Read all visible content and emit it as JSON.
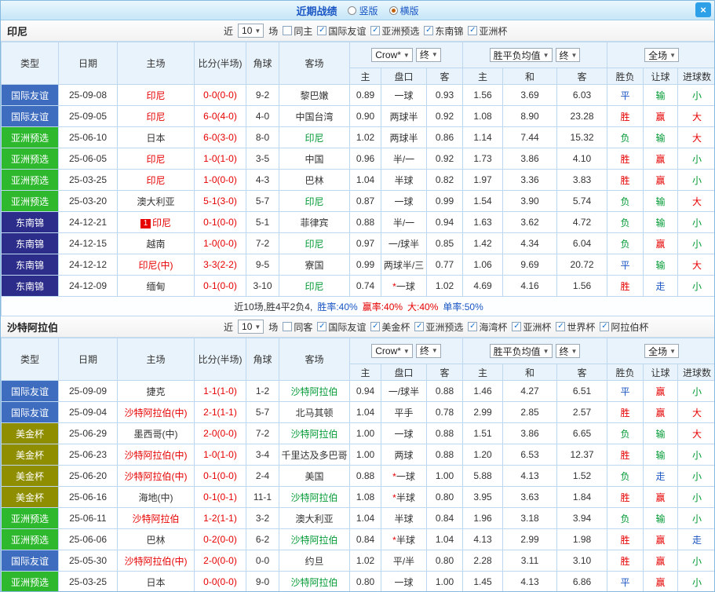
{
  "header": {
    "title": "近期战绩",
    "view_options": [
      {
        "label": "竖版",
        "selected": false
      },
      {
        "label": "横版",
        "selected": true
      }
    ],
    "close_icon": "×"
  },
  "icons": {
    "dropdown_arrow": "▼",
    "check": "✓"
  },
  "colors": {
    "red": "#e60000",
    "green": "#009933",
    "blue": "#1a56c4",
    "black": "#333333",
    "type_国际友谊": "#3e6cbf",
    "type_亚洲预选": "#2eb82e",
    "type_东南锦": "#2c2c8a",
    "type_美金杯": "#8e8e00"
  },
  "table_template": {
    "match_columns": [
      "类型",
      "日期",
      "主场",
      "比分(半场)",
      "角球",
      "客场"
    ],
    "odds_selects": [
      "Crow*",
      "终"
    ],
    "avg_selects": [
      "胜平负均值",
      "终"
    ],
    "result_select": "全场",
    "subheaders": [
      "主",
      "盘口",
      "客",
      "主",
      "和",
      "客",
      "胜负",
      "让球",
      "进球数"
    ],
    "filter": {
      "prefix": "近",
      "count": "10",
      "suffix": "场"
    }
  },
  "sections": [
    {
      "team": "印尼",
      "same_filter": {
        "label": "同主",
        "checked": false
      },
      "competitions": [
        {
          "label": "国际友谊",
          "checked": true
        },
        {
          "label": "亚洲预选",
          "checked": true
        },
        {
          "label": "东南锦",
          "checked": true
        },
        {
          "label": "亚洲杯",
          "checked": true
        }
      ],
      "rows": [
        {
          "type": "国际友谊",
          "date": "25-09-08",
          "home": "印尼",
          "home_color": "red",
          "home_badge": "",
          "score": "0-0(0-0)",
          "corners": "9-2",
          "away": "黎巴嫩",
          "away_color": "black",
          "h_home": "0.89",
          "handicap": "一球",
          "h_away": "0.93",
          "avg_home": "1.56",
          "avg_draw": "3.69",
          "avg_away": "6.03",
          "results": [
            [
              "平",
              "blue"
            ],
            [
              "输",
              "green"
            ],
            [
              "小",
              "green"
            ]
          ]
        },
        {
          "type": "国际友谊",
          "date": "25-09-05",
          "home": "印尼",
          "home_color": "red",
          "home_badge": "",
          "score": "6-0(4-0)",
          "corners": "4-0",
          "away": "中国台湾",
          "away_color": "black",
          "h_home": "0.90",
          "handicap": "两球半",
          "h_away": "0.92",
          "avg_home": "1.08",
          "avg_draw": "8.90",
          "avg_away": "23.28",
          "results": [
            [
              "胜",
              "red"
            ],
            [
              "赢",
              "red"
            ],
            [
              "大",
              "red"
            ]
          ]
        },
        {
          "type": "亚洲预选",
          "date": "25-06-10",
          "home": "日本",
          "home_color": "black",
          "home_badge": "",
          "score": "6-0(3-0)",
          "corners": "8-0",
          "away": "印尼",
          "away_color": "green",
          "h_home": "1.02",
          "handicap": "两球半",
          "h_away": "0.86",
          "avg_home": "1.14",
          "avg_draw": "7.44",
          "avg_away": "15.32",
          "results": [
            [
              "负",
              "green"
            ],
            [
              "输",
              "green"
            ],
            [
              "大",
              "red"
            ]
          ]
        },
        {
          "type": "亚洲预选",
          "date": "25-06-05",
          "home": "印尼",
          "home_color": "red",
          "home_badge": "",
          "score": "1-0(1-0)",
          "corners": "3-5",
          "away": "中国",
          "away_color": "black",
          "h_home": "0.96",
          "handicap": "半/一",
          "h_away": "0.92",
          "avg_home": "1.73",
          "avg_draw": "3.86",
          "avg_away": "4.10",
          "results": [
            [
              "胜",
              "red"
            ],
            [
              "赢",
              "red"
            ],
            [
              "小",
              "green"
            ]
          ]
        },
        {
          "type": "亚洲预选",
          "date": "25-03-25",
          "home": "印尼",
          "home_color": "red",
          "home_badge": "",
          "score": "1-0(0-0)",
          "corners": "4-3",
          "away": "巴林",
          "away_color": "black",
          "h_home": "1.04",
          "handicap": "半球",
          "h_away": "0.82",
          "avg_home": "1.97",
          "avg_draw": "3.36",
          "avg_away": "3.83",
          "results": [
            [
              "胜",
              "red"
            ],
            [
              "赢",
              "red"
            ],
            [
              "小",
              "green"
            ]
          ]
        },
        {
          "type": "亚洲预选",
          "date": "25-03-20",
          "home": "澳大利亚",
          "home_color": "black",
          "home_badge": "",
          "score": "5-1(3-0)",
          "corners": "5-7",
          "away": "印尼",
          "away_color": "green",
          "h_home": "0.87",
          "handicap": "一球",
          "h_away": "0.99",
          "avg_home": "1.54",
          "avg_draw": "3.90",
          "avg_away": "5.74",
          "results": [
            [
              "负",
              "green"
            ],
            [
              "输",
              "green"
            ],
            [
              "大",
              "red"
            ]
          ]
        },
        {
          "type": "东南锦",
          "date": "24-12-21",
          "home": "印尼",
          "home_color": "red",
          "home_badge": "1",
          "score": "0-1(0-0)",
          "corners": "5-1",
          "away": "菲律宾",
          "away_color": "black",
          "h_home": "0.88",
          "handicap": "半/一",
          "h_away": "0.94",
          "avg_home": "1.63",
          "avg_draw": "3.62",
          "avg_away": "4.72",
          "results": [
            [
              "负",
              "green"
            ],
            [
              "输",
              "green"
            ],
            [
              "小",
              "green"
            ]
          ]
        },
        {
          "type": "东南锦",
          "date": "24-12-15",
          "home": "越南",
          "home_color": "black",
          "home_badge": "",
          "score": "1-0(0-0)",
          "corners": "7-2",
          "away": "印尼",
          "away_color": "green",
          "h_home": "0.97",
          "handicap": "一/球半",
          "h_away": "0.85",
          "avg_home": "1.42",
          "avg_draw": "4.34",
          "avg_away": "6.04",
          "results": [
            [
              "负",
              "green"
            ],
            [
              "赢",
              "red"
            ],
            [
              "小",
              "green"
            ]
          ]
        },
        {
          "type": "东南锦",
          "date": "24-12-12",
          "home": "印尼(中)",
          "home_color": "red",
          "home_badge": "",
          "score": "3-3(2-2)",
          "corners": "9-5",
          "away": "寮国",
          "away_color": "black",
          "h_home": "0.99",
          "handicap": "两球半/三",
          "h_away": "0.77",
          "avg_home": "1.06",
          "avg_draw": "9.69",
          "avg_away": "20.72",
          "results": [
            [
              "平",
              "blue"
            ],
            [
              "输",
              "green"
            ],
            [
              "大",
              "red"
            ]
          ]
        },
        {
          "type": "东南锦",
          "date": "24-12-09",
          "home": "缅甸",
          "home_color": "black",
          "home_badge": "",
          "score": "0-1(0-0)",
          "corners": "3-10",
          "away": "印尼",
          "away_color": "green",
          "h_home": "0.74",
          "handicap": "*一球",
          "h_away": "1.02",
          "avg_home": "4.69",
          "avg_draw": "4.16",
          "avg_away": "1.56",
          "results": [
            [
              "胜",
              "red"
            ],
            [
              "走",
              "blue"
            ],
            [
              "小",
              "green"
            ]
          ]
        }
      ],
      "summary": [
        {
          "text": "近10场,胜4平2负4,",
          "color": "black"
        },
        {
          "text": "胜率:40%",
          "color": "blue"
        },
        {
          "text": "赢率:40%",
          "color": "red"
        },
        {
          "text": "大:40%",
          "color": "red"
        },
        {
          "text": "单率:50%",
          "color": "blue"
        }
      ]
    },
    {
      "team": "沙特阿拉伯",
      "same_filter": {
        "label": "同客",
        "checked": false
      },
      "competitions": [
        {
          "label": "国际友谊",
          "checked": true
        },
        {
          "label": "美金杯",
          "checked": true
        },
        {
          "label": "亚洲预选",
          "checked": true
        },
        {
          "label": "海湾杯",
          "checked": true
        },
        {
          "label": "亚洲杯",
          "checked": true
        },
        {
          "label": "世界杯",
          "checked": true
        },
        {
          "label": "阿拉伯杯",
          "checked": true
        }
      ],
      "rows": [
        {
          "type": "国际友谊",
          "date": "25-09-09",
          "home": "捷克",
          "home_color": "black",
          "home_badge": "",
          "score": "1-1(1-0)",
          "corners": "1-2",
          "away": "沙特阿拉伯",
          "away_color": "green",
          "h_home": "0.94",
          "handicap": "一/球半",
          "h_away": "0.88",
          "avg_home": "1.46",
          "avg_draw": "4.27",
          "avg_away": "6.51",
          "results": [
            [
              "平",
              "blue"
            ],
            [
              "赢",
              "red"
            ],
            [
              "小",
              "green"
            ]
          ]
        },
        {
          "type": "国际友谊",
          "date": "25-09-04",
          "home": "沙特阿拉伯(中)",
          "home_color": "red",
          "home_badge": "",
          "score": "2-1(1-1)",
          "corners": "5-7",
          "away": "北马其顿",
          "away_color": "black",
          "h_home": "1.04",
          "handicap": "平手",
          "h_away": "0.78",
          "avg_home": "2.99",
          "avg_draw": "2.85",
          "avg_away": "2.57",
          "results": [
            [
              "胜",
              "red"
            ],
            [
              "赢",
              "red"
            ],
            [
              "大",
              "red"
            ]
          ]
        },
        {
          "type": "美金杯",
          "date": "25-06-29",
          "home": "墨西哥(中)",
          "home_color": "black",
          "home_badge": "",
          "score": "2-0(0-0)",
          "corners": "7-2",
          "away": "沙特阿拉伯",
          "away_color": "green",
          "h_home": "1.00",
          "handicap": "一球",
          "h_away": "0.88",
          "avg_home": "1.51",
          "avg_draw": "3.86",
          "avg_away": "6.65",
          "results": [
            [
              "负",
              "green"
            ],
            [
              "输",
              "green"
            ],
            [
              "大",
              "red"
            ]
          ]
        },
        {
          "type": "美金杯",
          "date": "25-06-23",
          "home": "沙特阿拉伯(中)",
          "home_color": "red",
          "home_badge": "",
          "score": "1-0(1-0)",
          "corners": "3-4",
          "away": "千里达及多巴哥",
          "away_color": "black",
          "h_home": "1.00",
          "handicap": "两球",
          "h_away": "0.88",
          "avg_home": "1.20",
          "avg_draw": "6.53",
          "avg_away": "12.37",
          "results": [
            [
              "胜",
              "red"
            ],
            [
              "输",
              "green"
            ],
            [
              "小",
              "green"
            ]
          ]
        },
        {
          "type": "美金杯",
          "date": "25-06-20",
          "home": "沙特阿拉伯(中)",
          "home_color": "red",
          "home_badge": "",
          "score": "0-1(0-0)",
          "corners": "2-4",
          "away": "美国",
          "away_color": "black",
          "h_home": "0.88",
          "handicap": "*一球",
          "h_away": "1.00",
          "avg_home": "5.88",
          "avg_draw": "4.13",
          "avg_away": "1.52",
          "results": [
            [
              "负",
              "green"
            ],
            [
              "走",
              "blue"
            ],
            [
              "小",
              "green"
            ]
          ]
        },
        {
          "type": "美金杯",
          "date": "25-06-16",
          "home": "海地(中)",
          "home_color": "black",
          "home_badge": "",
          "score": "0-1(0-1)",
          "corners": "11-1",
          "away": "沙特阿拉伯",
          "away_color": "green",
          "h_home": "1.08",
          "handicap": "*半球",
          "h_away": "0.80",
          "avg_home": "3.95",
          "avg_draw": "3.63",
          "avg_away": "1.84",
          "results": [
            [
              "胜",
              "red"
            ],
            [
              "赢",
              "red"
            ],
            [
              "小",
              "green"
            ]
          ]
        },
        {
          "type": "亚洲预选",
          "date": "25-06-11",
          "home": "沙特阿拉伯",
          "home_color": "red",
          "home_badge": "",
          "score": "1-2(1-1)",
          "corners": "3-2",
          "away": "澳大利亚",
          "away_color": "black",
          "h_home": "1.04",
          "handicap": "半球",
          "h_away": "0.84",
          "avg_home": "1.96",
          "avg_draw": "3.18",
          "avg_away": "3.94",
          "results": [
            [
              "负",
              "green"
            ],
            [
              "输",
              "green"
            ],
            [
              "小",
              "green"
            ]
          ]
        },
        {
          "type": "亚洲预选",
          "date": "25-06-06",
          "home": "巴林",
          "home_color": "black",
          "home_badge": "",
          "score": "0-2(0-0)",
          "corners": "6-2",
          "away": "沙特阿拉伯",
          "away_color": "green",
          "h_home": "0.84",
          "handicap": "*半球",
          "h_away": "1.04",
          "avg_home": "4.13",
          "avg_draw": "2.99",
          "avg_away": "1.98",
          "results": [
            [
              "胜",
              "red"
            ],
            [
              "赢",
              "red"
            ],
            [
              "走",
              "blue"
            ]
          ]
        },
        {
          "type": "国际友谊",
          "date": "25-05-30",
          "home": "沙特阿拉伯(中)",
          "home_color": "red",
          "home_badge": "",
          "score": "2-0(0-0)",
          "corners": "0-0",
          "away": "约旦",
          "away_color": "black",
          "h_home": "1.02",
          "handicap": "平/半",
          "h_away": "0.80",
          "avg_home": "2.28",
          "avg_draw": "3.11",
          "avg_away": "3.10",
          "results": [
            [
              "胜",
              "red"
            ],
            [
              "赢",
              "red"
            ],
            [
              "小",
              "green"
            ]
          ]
        },
        {
          "type": "亚洲预选",
          "date": "25-03-25",
          "home": "日本",
          "home_color": "black",
          "home_badge": "",
          "score": "0-0(0-0)",
          "corners": "9-0",
          "away": "沙特阿拉伯",
          "away_color": "green",
          "h_home": "0.80",
          "handicap": "一球",
          "h_away": "1.00",
          "avg_home": "1.45",
          "avg_draw": "4.13",
          "avg_away": "6.86",
          "results": [
            [
              "平",
              "blue"
            ],
            [
              "赢",
              "red"
            ],
            [
              "小",
              "green"
            ]
          ]
        }
      ],
      "summary": []
    }
  ]
}
